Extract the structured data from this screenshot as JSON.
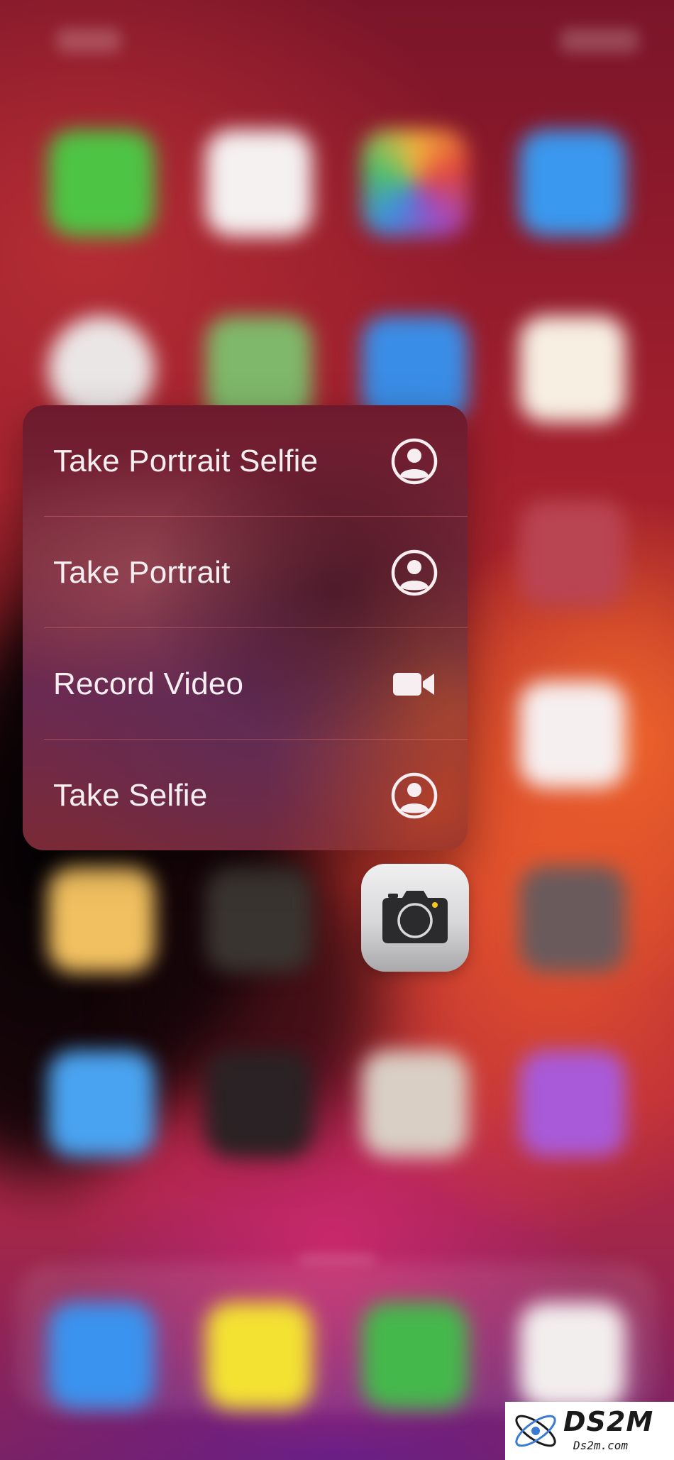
{
  "menu": {
    "items": [
      {
        "label": "Take Portrait Selfie",
        "icon": "person-circle-icon"
      },
      {
        "label": "Take Portrait",
        "icon": "person-circle-icon"
      },
      {
        "label": "Record Video",
        "icon": "video-camera-icon"
      },
      {
        "label": "Take Selfie",
        "icon": "person-circle-icon"
      }
    ]
  },
  "app": {
    "name": "Camera",
    "icon": "camera-icon"
  },
  "watermark": {
    "logo_text": "DS2M",
    "url_text": "Ds2m.com"
  }
}
